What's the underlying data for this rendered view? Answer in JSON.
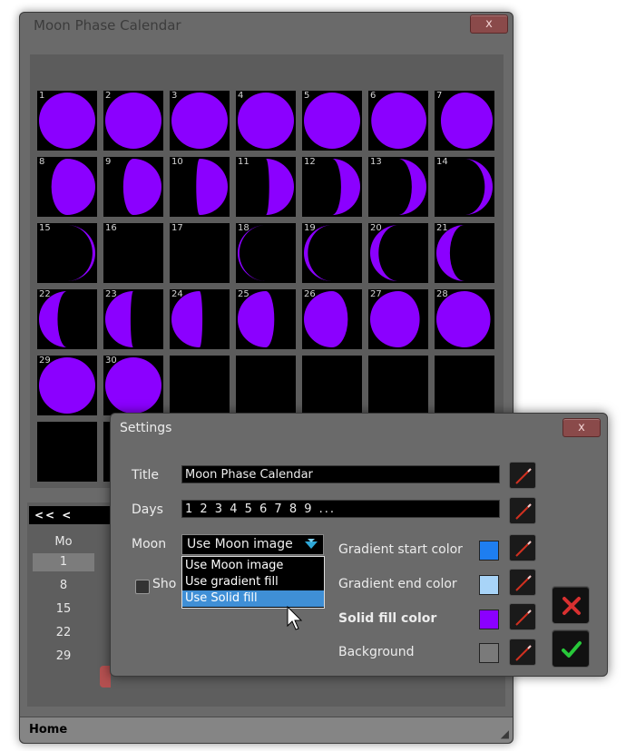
{
  "main_window": {
    "title": "Moon Phase Calendar",
    "close_label": "x",
    "status": "Home"
  },
  "calendar": {
    "days": [
      {
        "n": "1",
        "phase": 1.0
      },
      {
        "n": "2",
        "phase": 1.0
      },
      {
        "n": "3",
        "phase": 1.0
      },
      {
        "n": "4",
        "phase": 1.0
      },
      {
        "n": "5",
        "phase": 1.0
      },
      {
        "n": "6",
        "phase": 0.98
      },
      {
        "n": "7",
        "phase": 0.92
      },
      {
        "n": "8",
        "phase": 0.78
      },
      {
        "n": "9",
        "phase": 0.68
      },
      {
        "n": "10",
        "phase": 0.56
      },
      {
        "n": "11",
        "phase": 0.44
      },
      {
        "n": "12",
        "phase": 0.34
      },
      {
        "n": "13",
        "phase": 0.26
      },
      {
        "n": "14",
        "phase": 0.14
      },
      {
        "n": "15",
        "phase": 0.05
      },
      {
        "n": "16",
        "phase": 0
      },
      {
        "n": "17",
        "phase": 0
      },
      {
        "n": "18",
        "phase": -0.03
      },
      {
        "n": "19",
        "phase": -0.07
      },
      {
        "n": "20",
        "phase": -0.15
      },
      {
        "n": "21",
        "phase": -0.24
      },
      {
        "n": "22",
        "phase": -0.33
      },
      {
        "n": "23",
        "phase": -0.45
      },
      {
        "n": "24",
        "phase": -0.55
      },
      {
        "n": "25",
        "phase": -0.65
      },
      {
        "n": "26",
        "phase": -0.78
      },
      {
        "n": "27",
        "phase": -0.88
      },
      {
        "n": "28",
        "phase": -0.96
      },
      {
        "n": "29",
        "phase": 1.0
      },
      {
        "n": "30",
        "phase": 1.0
      }
    ],
    "moon_color": "#8b00ff"
  },
  "nav": {
    "prev_label": "<<  <",
    "weekday_header": "Mo",
    "dates": [
      "1",
      "8",
      "15",
      "22",
      "29"
    ],
    "selected_index": 0
  },
  "settings": {
    "title": "Settings",
    "close_label": "x",
    "title_label": "Title",
    "title_value": "Moon Phase Calendar",
    "days_label": "Days",
    "days_value": "1 2 3 4 5 6 7 8 9 ...",
    "moon_label": "Moon",
    "moon_selected": "Use Moon image",
    "moon_options": [
      "Use Moon image",
      "Use gradient fill",
      "Use Solid fill"
    ],
    "highlighted_index": 2,
    "show_label": "Sho",
    "gradient_start_label": "Gradient start color",
    "gradient_end_label": "Gradient end color",
    "solid_fill_label": "Solid fill color",
    "background_label": "Background",
    "colors": {
      "gradient_start": "#1e7ef0",
      "gradient_end": "#a8d4f8",
      "solid_fill": "#8b00ff",
      "background": "#7a7a7a"
    }
  }
}
